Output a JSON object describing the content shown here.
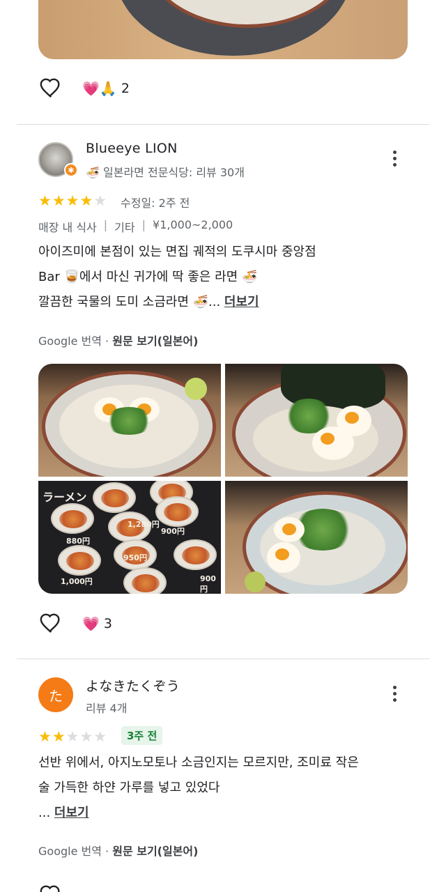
{
  "top_post": {
    "reaction_emojis": "💗🙏",
    "reaction_count": "2"
  },
  "review1": {
    "name": "Blueeye LION",
    "meta": "🍜 일본라면 전문식당: 리뷰 30개",
    "rating": 4,
    "edited": "수정일: 2주 전",
    "tags": [
      "매장 내 식사",
      "기타",
      "¥1,000~2,000"
    ],
    "tag_separator": "|",
    "lines": [
      "아이즈미에 본점이 있는 면집 궤적의 도쿠시마 중앙점",
      "Bar 🥃에서 마신 귀가에 딱 좋은 라면 🍜",
      "깔끔한 국물의 도미 소금라면 🍜..."
    ],
    "more_label": "더보기",
    "translate_prefix": "Google 번역 · ",
    "translate_link": "원문 보기(일본어)",
    "photo_menu_texts": [
      "ラーメン",
      "880円",
      "1,280円",
      "900円",
      "950円",
      "1,000円",
      "900円"
    ],
    "reaction_emoji": "💗",
    "reaction_count": "3"
  },
  "review2": {
    "avatar_letter": "た",
    "name": "よなきたくぞう",
    "meta": "리뷰 4개",
    "rating": 2,
    "time_chip": "3주 전",
    "lines": [
      "선반 위에서, 아지노모토나 소금인지는 모르지만, 조미료 작은",
      "술 가득한 하얀 가루를 넣고 있었다"
    ],
    "ellipsis": "...",
    "more_label": "더보기",
    "translate_prefix": "Google 번역 · ",
    "translate_link": "원문 보기(일본어)"
  },
  "icons": {
    "heart_outline": "heart-outline-icon",
    "more": "more-vert-icon",
    "star": "★"
  },
  "colors": {
    "star_on": "#fbbc04",
    "star_off": "#dadce0",
    "chip_bg": "#e6f4ea",
    "chip_text": "#188038",
    "avatar_orange": "#f47b16"
  }
}
